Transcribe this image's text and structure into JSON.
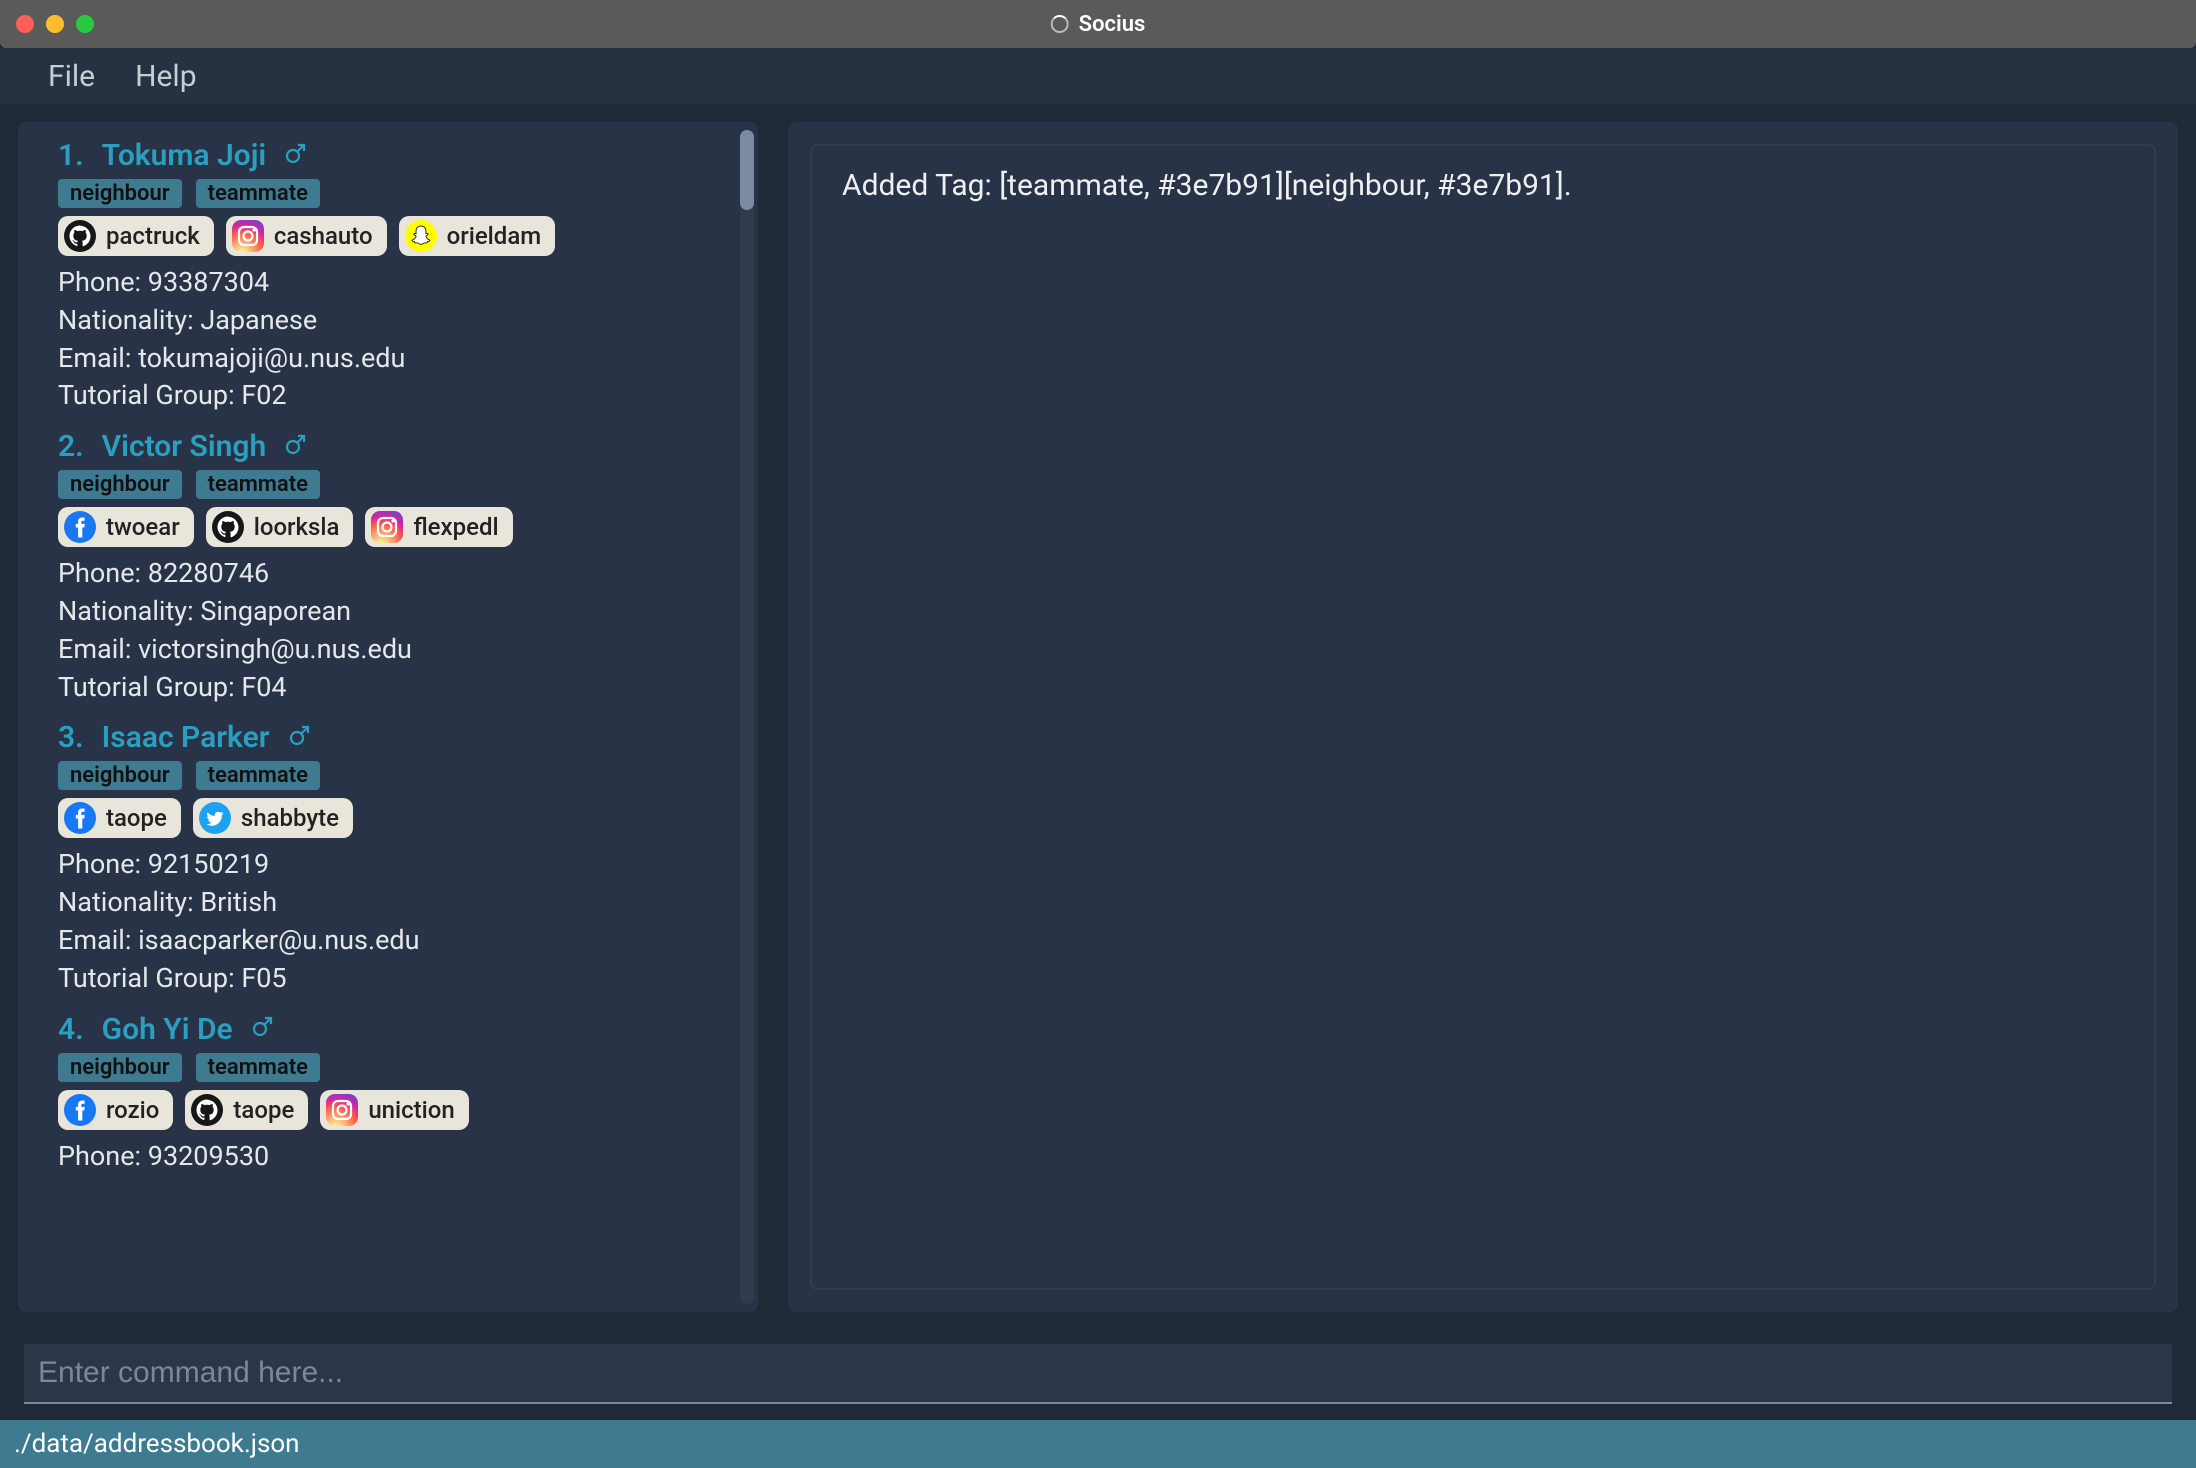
{
  "window": {
    "title": "Socius"
  },
  "menubar": {
    "file": "File",
    "help": "Help"
  },
  "result": {
    "text": "Added Tag: [teammate, #3e7b91][neighbour, #3e7b91]."
  },
  "command": {
    "placeholder": "Enter command here..."
  },
  "statusbar": {
    "path": "./data/addressbook.json"
  },
  "icons": {
    "github": "github-icon",
    "instagram": "instagram-icon",
    "snapchat": "snapchat-icon",
    "facebook": "facebook-icon",
    "twitter": "twitter-icon"
  },
  "persons": [
    {
      "index": "1.",
      "name": "Tokuma Joji",
      "gender": "male",
      "tags": [
        "neighbour",
        "teammate"
      ],
      "socials": [
        {
          "platform": "github",
          "handle": "pactruck"
        },
        {
          "platform": "instagram",
          "handle": "cashauto"
        },
        {
          "platform": "snapchat",
          "handle": "orieldam"
        }
      ],
      "phone": "Phone: 93387304",
      "nationality": "Nationality: Japanese",
      "email": "Email: tokumajoji@u.nus.edu",
      "tutorial": "Tutorial Group: F02"
    },
    {
      "index": "2.",
      "name": "Victor Singh",
      "gender": "male",
      "tags": [
        "neighbour",
        "teammate"
      ],
      "socials": [
        {
          "platform": "facebook",
          "handle": "twoear"
        },
        {
          "platform": "github",
          "handle": "loorksla"
        },
        {
          "platform": "instagram",
          "handle": "flexpedl"
        }
      ],
      "phone": "Phone: 82280746",
      "nationality": "Nationality: Singaporean",
      "email": "Email: victorsingh@u.nus.edu",
      "tutorial": "Tutorial Group: F04"
    },
    {
      "index": "3.",
      "name": "Isaac Parker",
      "gender": "male",
      "tags": [
        "neighbour",
        "teammate"
      ],
      "socials": [
        {
          "platform": "facebook",
          "handle": "taope"
        },
        {
          "platform": "twitter",
          "handle": "shabbyte"
        }
      ],
      "phone": "Phone: 92150219",
      "nationality": "Nationality: British",
      "email": "Email: isaacparker@u.nus.edu",
      "tutorial": "Tutorial Group: F05"
    },
    {
      "index": "4.",
      "name": "Goh Yi De",
      "gender": "male",
      "tags": [
        "neighbour",
        "teammate"
      ],
      "socials": [
        {
          "platform": "facebook",
          "handle": "rozio"
        },
        {
          "platform": "github",
          "handle": "taope"
        },
        {
          "platform": "instagram",
          "handle": "uniction"
        }
      ],
      "phone": "Phone: 93209530",
      "nationality": "",
      "email": "",
      "tutorial": ""
    }
  ]
}
